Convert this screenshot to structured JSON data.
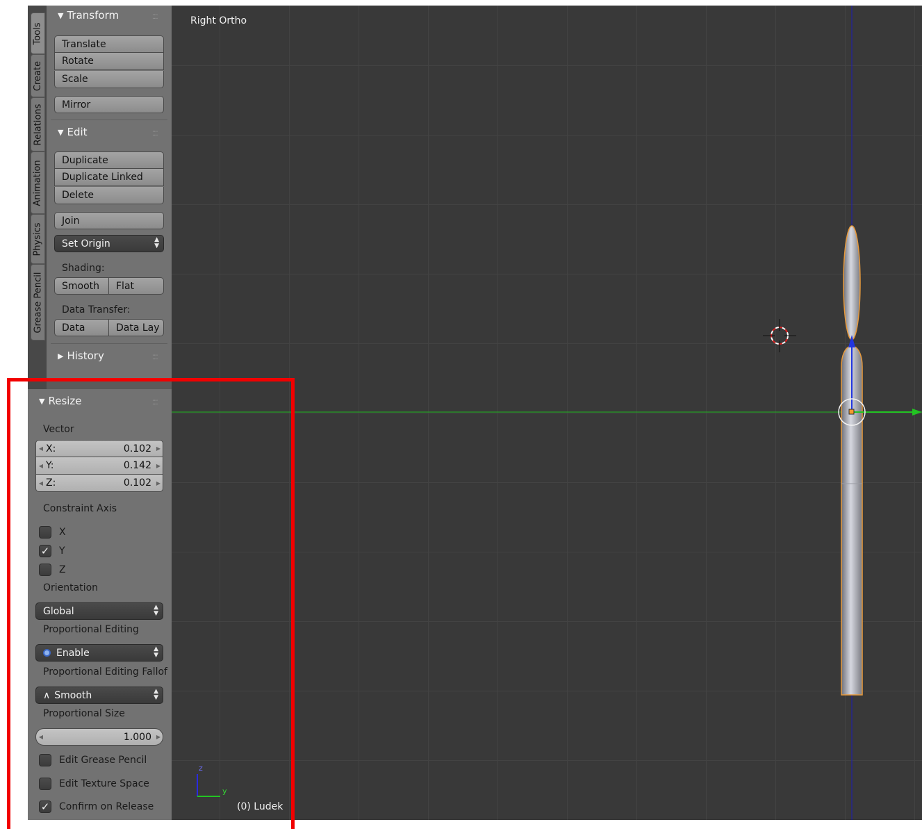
{
  "tabs": [
    "Tools",
    "Create",
    "Relations",
    "Animation",
    "Physics",
    "Grease Pencil"
  ],
  "transform": {
    "header": "Transform",
    "buttons": [
      "Translate",
      "Rotate",
      "Scale"
    ],
    "mirror": "Mirror"
  },
  "edit": {
    "header": "Edit",
    "buttons": [
      "Duplicate",
      "Duplicate Linked",
      "Delete"
    ],
    "join": "Join",
    "set_origin": "Set Origin",
    "shading_label": "Shading:",
    "smooth": "Smooth",
    "flat": "Flat",
    "data_transfer_label": "Data Transfer:",
    "data": "Data",
    "data_lay": "Data Lay"
  },
  "history": {
    "header": "History"
  },
  "resize": {
    "header": "Resize",
    "vector_label": "Vector",
    "vector": [
      {
        "axis": "X:",
        "value": "0.102"
      },
      {
        "axis": "Y:",
        "value": "0.142"
      },
      {
        "axis": "Z:",
        "value": "0.102"
      }
    ],
    "constraint_label": "Constraint Axis",
    "constraints": [
      {
        "label": "X",
        "checked": false
      },
      {
        "label": "Y",
        "checked": true
      },
      {
        "label": "Z",
        "checked": false
      }
    ],
    "orientation_label": "Orientation",
    "orientation": "Global",
    "prop_label": "Proportional Editing",
    "prop": "Enable",
    "falloff_label": "Proportional Editing Fallof",
    "falloff": "Smooth",
    "size_label": "Proportional Size",
    "size": "1.000",
    "options": [
      {
        "label": "Edit Grease Pencil",
        "checked": false
      },
      {
        "label": "Edit Texture Space",
        "checked": false
      },
      {
        "label": "Confirm on Release",
        "checked": true
      }
    ]
  },
  "viewport": {
    "title": "Right Ortho",
    "object": "(0) Ludek",
    "axis_z": "z",
    "axis_y": "y"
  },
  "colors": {
    "viewport_bg": "#393939",
    "panel_bg": "#727272",
    "y_axis": "#1fb51f",
    "z_axis": "#1a1ab8",
    "selection": "#e89a3c",
    "highlight": "#f20000"
  }
}
